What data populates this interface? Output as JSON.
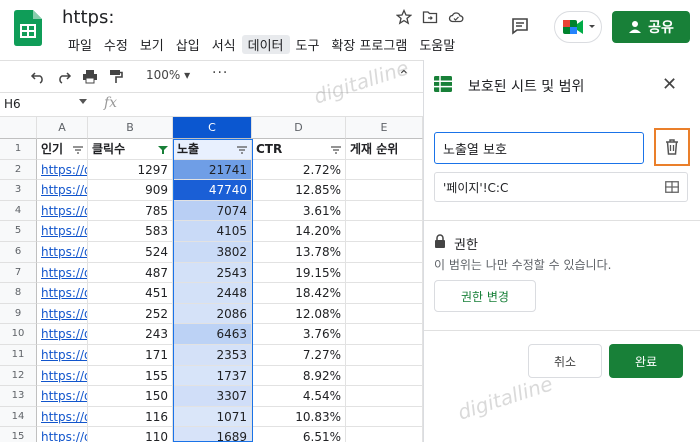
{
  "header": {
    "title": "https:",
    "menu": [
      "파일",
      "수정",
      "보기",
      "삽입",
      "서식",
      "데이터",
      "도구",
      "확장 프로그램",
      "도움말"
    ],
    "share_label": "공유"
  },
  "toolbar": {
    "zoom": "100%",
    "more": "···"
  },
  "formula_bar": {
    "name_box": "H6",
    "fx": "fx"
  },
  "grid": {
    "columns": [
      "A",
      "B",
      "C",
      "D",
      "E"
    ],
    "header_row": [
      "인기",
      "클릭수",
      "노출",
      "CTR",
      "게재 순위"
    ],
    "rows": [
      {
        "num": "2",
        "a": "https://di",
        "b": "1297",
        "c": "21741",
        "d": "2.72%"
      },
      {
        "num": "3",
        "a": "https://di",
        "b": "909",
        "c": "47740",
        "d": "12.85%"
      },
      {
        "num": "4",
        "a": "https://di",
        "b": "785",
        "c": "7074",
        "d": "3.61%"
      },
      {
        "num": "5",
        "a": "https://di",
        "b": "583",
        "c": "4105",
        "d": "14.20%"
      },
      {
        "num": "6",
        "a": "https://di",
        "b": "524",
        "c": "3802",
        "d": "13.78%"
      },
      {
        "num": "7",
        "a": "https://di",
        "b": "487",
        "c": "2543",
        "d": "19.15%"
      },
      {
        "num": "8",
        "a": "https://di",
        "b": "451",
        "c": "2448",
        "d": "18.42%"
      },
      {
        "num": "9",
        "a": "https://di",
        "b": "252",
        "c": "2086",
        "d": "12.08%"
      },
      {
        "num": "10",
        "a": "https://di",
        "b": "243",
        "c": "6463",
        "d": "3.76%"
      },
      {
        "num": "11",
        "a": "https://di",
        "b": "171",
        "c": "2353",
        "d": "7.27%"
      },
      {
        "num": "12",
        "a": "https://di",
        "b": "155",
        "c": "1737",
        "d": "8.92%"
      },
      {
        "num": "13",
        "a": "https://di",
        "b": "150",
        "c": "3307",
        "d": "4.54%"
      },
      {
        "num": "14",
        "a": "https://di",
        "b": "116",
        "c": "1071",
        "d": "10.83%"
      },
      {
        "num": "15",
        "a": "https://di",
        "b": "110",
        "c": "1689",
        "d": "6.51%"
      }
    ],
    "c_highlight": [
      "#6f9ee6",
      "#1a5fd6",
      "#b9cff4",
      "#c9daf7",
      "#cadbf7",
      "#d3e1f8",
      "#d3e1f8",
      "#d5e2f8",
      "#bcd2f5",
      "#d4e1f8",
      "#d7e4f9",
      "#d0def8",
      "#dae6f9",
      "#d7e3f9"
    ]
  },
  "panel": {
    "title": "보호된 시트 및 범위",
    "description_value": "노출열 보호",
    "range_value": "'페이지'!C:C",
    "permission_title": "권한",
    "permission_desc": "이 범위는 나만 수정할 수 있습니다.",
    "permission_button": "권한 변경",
    "cancel_label": "취소",
    "done_label": "완료"
  },
  "watermark": "digitalline",
  "colors": {
    "accent_green": "#188038",
    "selection_blue": "#0b57d0",
    "delete_highlight": "#ea7f2a"
  }
}
